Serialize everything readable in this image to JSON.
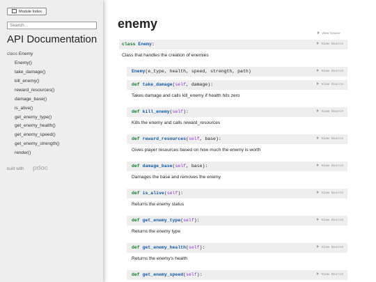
{
  "sidebar": {
    "module_index_label": "Module Index",
    "search_placeholder": "Search...",
    "title": "API Documentation",
    "class_keyword": "class",
    "class_name": "Enemy",
    "items": [
      "Enemy()",
      "take_damage()",
      "kill_enemy()",
      "reward_resources()",
      "damage_base()",
      "is_alive()",
      "get_enemy_type()",
      "get_enemy_health()",
      "get_enemy_speed()",
      "get_enemy_strength()",
      "render()"
    ],
    "built_with": "built with",
    "logo": "pdoc"
  },
  "main": {
    "module_name": "enemy",
    "view_source": "View Source",
    "class_sig": {
      "keyword": "class",
      "name": "Enemy",
      "suffix": ":"
    },
    "class_doc": "Class that handles the creation of enemies",
    "constructor": {
      "name": "Enemy",
      "params": "(e_type, health, speed, strength, path)"
    },
    "methods": [
      {
        "name": "take_damage",
        "params": ", damage):",
        "doc": "Takes damage and calls kill_enemy if health hits zero"
      },
      {
        "name": "kill_enemy",
        "params": "):",
        "doc": "Kills the enemy and calls reward_resources"
      },
      {
        "name": "reward_resources",
        "params": ", base):",
        "doc": "Gives player resources based on how much the enemy is worth"
      },
      {
        "name": "damage_base",
        "params": ", base):",
        "doc": "Damages the base and removes the enemy"
      },
      {
        "name": "is_alive",
        "params": "):",
        "doc": "Returns the enemy status"
      },
      {
        "name": "get_enemy_type",
        "params": "):",
        "doc": "Returns the enemy type"
      },
      {
        "name": "get_enemy_health",
        "params": "):",
        "doc": "Returns the enemy's health"
      },
      {
        "name": "get_enemy_speed",
        "params": "):",
        "doc": ""
      }
    ],
    "def_keyword": "def",
    "self_keyword": "self",
    "open_paren": "("
  }
}
